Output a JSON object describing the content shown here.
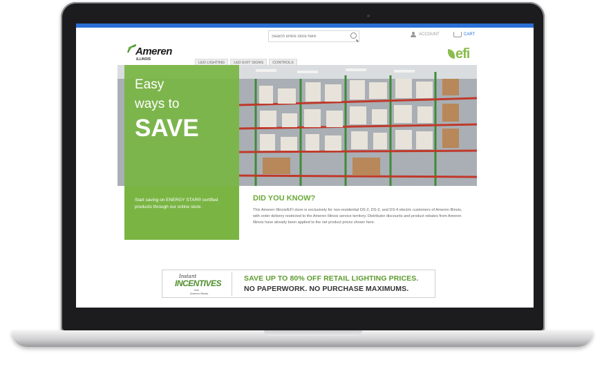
{
  "header": {
    "search_placeholder": "Search entire store here",
    "account_label": "ACCOUNT",
    "cart_label": "CART"
  },
  "logo": {
    "brand": "Ameren",
    "sub": "ILLINOIS",
    "efi": "efi"
  },
  "nav": {
    "tabs": [
      "LED LIGHTING",
      "LED EXIT SIGNS",
      "CONTROLS"
    ]
  },
  "hero": {
    "line1": "Easy",
    "line2": "ways to",
    "line3": "SAVE"
  },
  "promo": {
    "text": "Start saving on ENERGY STAR® certified products through our online store."
  },
  "did_you_know": {
    "title": "DID YOU KNOW?",
    "body": "This Ameren Illinois/EFI store is exclusively for non-residential DS-2, DS-3, and DS-4 electric customers of Ameren Illinois, with order delivery restricted to the Ameren Illinois service territory. Distributor discounts and product rebates from Ameren Illinois have already been applied to the net product prices shown here."
  },
  "banner": {
    "instant": "Instant",
    "incentives": "INCENTIVES",
    "from": "from",
    "ameren": "Ameren Illinois",
    "line1": "SAVE UP TO 80% OFF RETAIL LIGHTING PRICES.",
    "line2": "NO PAPERWORK.  NO PURCHASE MAXIMUMS."
  },
  "colors": {
    "accent_green": "#7ab544",
    "top_bar_blue": "#2a6fd6"
  },
  "icons": [
    "search-icon",
    "account-icon",
    "cart-icon"
  ]
}
